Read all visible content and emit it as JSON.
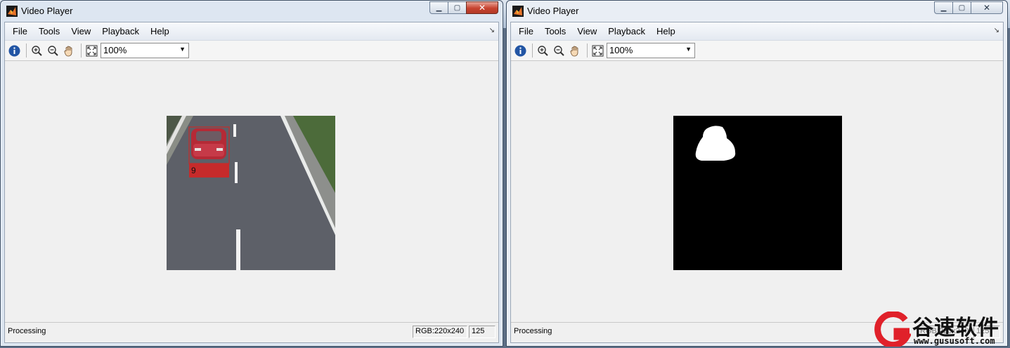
{
  "watermark": {
    "name": "谷速软件",
    "url": "www.gususoft.com"
  },
  "windows": [
    {
      "title": "Video Player",
      "menu": [
        "File",
        "Tools",
        "View",
        "Playback",
        "Help"
      ],
      "zoom": "100%",
      "status": "Processing",
      "dimensions": "RGB:220x240",
      "frame": "125",
      "overlay_label": "9",
      "colors": {
        "box": "#c62b2b",
        "road": "#5d6068"
      }
    },
    {
      "title": "Video Player",
      "menu": [
        "File",
        "Tools",
        "View",
        "Playback",
        "Help"
      ],
      "zoom": "100%",
      "status": "Processing",
      "dimensions": "RGB:220x240",
      "frame": "125",
      "colors": {
        "mask_bg": "#000000",
        "blob": "#ffffff"
      }
    }
  ]
}
